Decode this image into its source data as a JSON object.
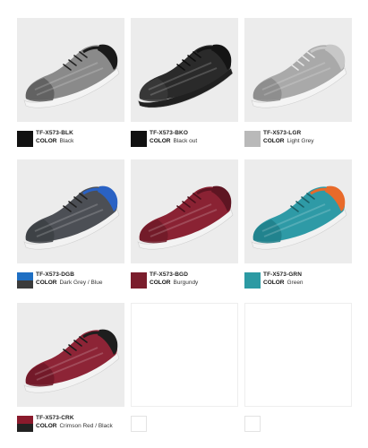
{
  "products": [
    {
      "code": "TF-X573-BLK",
      "color_label": "COLOR",
      "color_name": "Black",
      "swatch": [
        "#111111"
      ],
      "shoe": {
        "upper": "#8a8a8a",
        "toe": "#5a5a5a",
        "heel": "#1a1a1a",
        "sole": "#f4f4f4",
        "lace": "#222222"
      }
    },
    {
      "code": "TF-X573-BKO",
      "color_label": "COLOR",
      "color_name": "Black out",
      "swatch": [
        "#111111"
      ],
      "shoe": {
        "upper": "#2a2a2a",
        "toe": "#3a3a3a",
        "heel": "#141414",
        "sole": "#202020",
        "lace": "#0e0e0e"
      }
    },
    {
      "code": "TF-X573-LGR",
      "color_label": "COLOR",
      "color_name": "Light Grey",
      "swatch": [
        "#b9b9b9"
      ],
      "shoe": {
        "upper": "#a9a9a9",
        "toe": "#8a8a8a",
        "heel": "#c7c7c7",
        "sole": "#f4f4f4",
        "lace": "#e8e8e8"
      }
    },
    {
      "code": "TF-X573-DGB",
      "color_label": "COLOR",
      "color_name": "Dark Grey / Blue",
      "swatch": [
        "#1f6fc3",
        "#3b3b3b"
      ],
      "shoe": {
        "upper": "#4c4f55",
        "toe": "#3c3f44",
        "heel": "#2a62c4",
        "sole": "#f2f2f2",
        "lace": "#202020"
      }
    },
    {
      "code": "TF-X573-BGD",
      "color_label": "COLOR",
      "color_name": "Burgundy",
      "swatch": [
        "#7a1d2c"
      ],
      "shoe": {
        "upper": "#8a2233",
        "toe": "#6f1a28",
        "heel": "#5e1522",
        "sole": "#f3f3f3",
        "lace": "#4a0f1a"
      }
    },
    {
      "code": "TF-X573-GRN",
      "color_label": "COLOR",
      "color_name": "Green",
      "swatch": [
        "#2c9aa3"
      ],
      "shoe": {
        "upper": "#2e9aa6",
        "toe": "#1f7f8a",
        "heel": "#e86a2a",
        "sole": "#f2f2f2",
        "lace": "#1b5f66"
      }
    },
    {
      "code": "TF-X573-CRK",
      "color_label": "COLOR",
      "color_name": "Crimson Red / Black",
      "swatch": [
        "#8a1a2c",
        "#222222"
      ],
      "shoe": {
        "upper": "#8d2436",
        "toe": "#6e1827",
        "heel": "#1e1e1e",
        "sole": "#f3f3f3",
        "lace": "#1a1a1a"
      }
    }
  ]
}
